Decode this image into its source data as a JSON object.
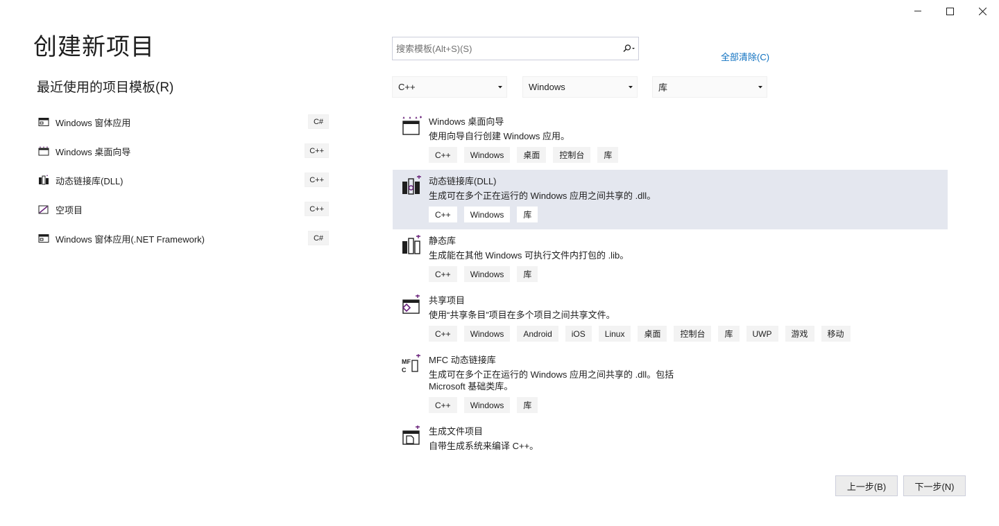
{
  "page_title": "创建新项目",
  "recent": {
    "title": "最近使用的项目模板(R)",
    "items": [
      {
        "label": "Windows 窗体应用",
        "badge": "C#",
        "icon": "winforms-icon"
      },
      {
        "label": "Windows 桌面向导",
        "badge": "C++",
        "icon": "desktop-wizard-icon"
      },
      {
        "label": "动态链接库(DLL)",
        "badge": "C++",
        "icon": "dll-icon"
      },
      {
        "label": "空项目",
        "badge": "C++",
        "icon": "empty-project-icon"
      },
      {
        "label": "Windows 窗体应用(.NET Framework)",
        "badge": "C#",
        "icon": "winforms-icon"
      }
    ]
  },
  "search": {
    "placeholder": "搜索模板(Alt+S)(S)",
    "value": ""
  },
  "clear_all": "全部清除(C)",
  "filters": {
    "language": "C++",
    "platform": "Windows",
    "project_type": "库"
  },
  "templates": [
    {
      "name": "Windows 桌面向导",
      "desc": "使用向导自行创建 Windows 应用。",
      "tags": [
        "C++",
        "Windows",
        "桌面",
        "控制台",
        "库"
      ],
      "selected": false
    },
    {
      "name": "动态链接库(DLL)",
      "desc": "生成可在多个正在运行的 Windows 应用之间共享的 .dll。",
      "tags": [
        "C++",
        "Windows",
        "库"
      ],
      "selected": true
    },
    {
      "name": "静态库",
      "desc": "生成能在其他 Windows 可执行文件内打包的 .lib。",
      "tags": [
        "C++",
        "Windows",
        "库"
      ],
      "selected": false
    },
    {
      "name": "共享项目",
      "desc": "使用“共享条目”项目在多个项目之间共享文件。",
      "tags": [
        "C++",
        "Windows",
        "Android",
        "iOS",
        "Linux",
        "桌面",
        "控制台",
        "库",
        "UWP",
        "游戏",
        "移动"
      ],
      "selected": false
    },
    {
      "name": "MFC 动态链接库",
      "desc": "生成可在多个正在运行的 Windows 应用之间共享的 .dll。包括 Microsoft 基础类库。",
      "tags": [
        "C++",
        "Windows",
        "库"
      ],
      "selected": false
    },
    {
      "name": "生成文件项目",
      "desc": "自带生成系统来编译 C++。",
      "tags": [],
      "selected": false
    }
  ],
  "buttons": {
    "back": "上一步(B)",
    "next": "下一步(N)"
  },
  "colors": {
    "accent_link": "#0e70c0",
    "selected_row": "#e4e7ef",
    "icon_purple": "#68217a"
  }
}
